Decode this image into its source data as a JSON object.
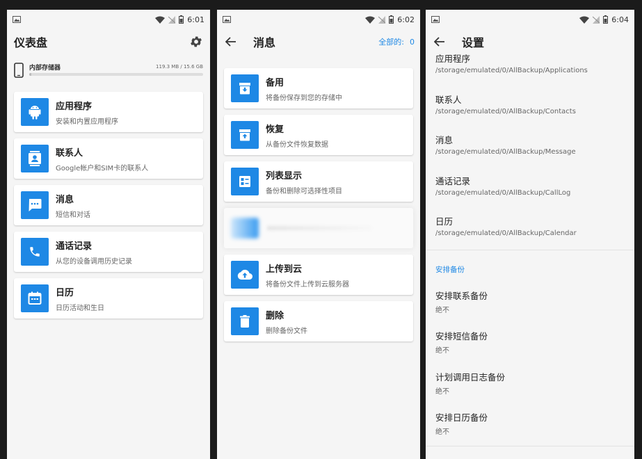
{
  "colors": {
    "accent": "#1e88e5",
    "background": "#f5f5f5"
  },
  "screens": {
    "dashboard": {
      "time": "6:01",
      "title": "仪表盘",
      "storage": {
        "label": "内部存储器",
        "size": "119.3 MB / 15.6 GB",
        "used_fraction": 0.008
      },
      "cards": [
        {
          "icon": "android-icon",
          "title": "应用程序",
          "subtitle": "安装和内置应用程序"
        },
        {
          "icon": "contact-icon",
          "title": "联系人",
          "subtitle": "Google帐户和SIM卡的联系人"
        },
        {
          "icon": "message-icon",
          "title": "消息",
          "subtitle": "短信和对话"
        },
        {
          "icon": "phone-icon",
          "title": "通话记录",
          "subtitle": "从您的设备调用历史记录"
        },
        {
          "icon": "calendar-icon",
          "title": "日历",
          "subtitle": "日历活动和生日"
        }
      ]
    },
    "messages": {
      "time": "6:02",
      "title": "消息",
      "all_label": "全部的:",
      "all_count": "0",
      "cards": [
        {
          "icon": "backup-icon",
          "title": "备用",
          "subtitle": "将备份保存到您的存储中"
        },
        {
          "icon": "restore-icon",
          "title": "恢复",
          "subtitle": "从备份文件恢复数据"
        },
        {
          "icon": "list-icon",
          "title": "列表显示",
          "subtitle": "备份和删除可选择性项目"
        },
        {
          "icon": "cloud-upload-icon",
          "title": "上传到云",
          "subtitle": "将备份文件上传到云服务器"
        },
        {
          "icon": "delete-icon",
          "title": "删除",
          "subtitle": "删除备份文件"
        }
      ]
    },
    "settings": {
      "time": "6:04",
      "title": "设置",
      "paths": [
        {
          "title": "应用程序",
          "value": "/storage/emulated/0/AllBackup/Applications"
        },
        {
          "title": "联系人",
          "value": "/storage/emulated/0/AllBackup/Contacts"
        },
        {
          "title": "消息",
          "value": "/storage/emulated/0/AllBackup/Message"
        },
        {
          "title": "通话记录",
          "value": "/storage/emulated/0/AllBackup/CallLog"
        },
        {
          "title": "日历",
          "value": "/storage/emulated/0/AllBackup/Calendar"
        }
      ],
      "schedule_section": "安排备份",
      "schedules": [
        {
          "title": "安排联系备份",
          "value": "绝不"
        },
        {
          "title": "安排短信备份",
          "value": "绝不"
        },
        {
          "title": "计划调用日志备份",
          "value": "绝不"
        },
        {
          "title": "安排日历备份",
          "value": "绝不"
        }
      ]
    }
  }
}
